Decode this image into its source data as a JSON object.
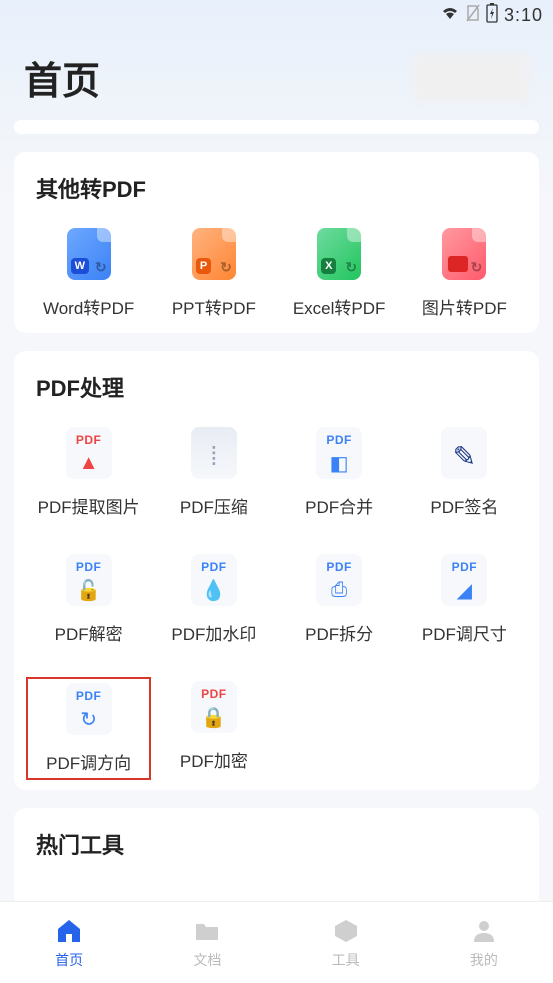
{
  "status": {
    "time": "3:10"
  },
  "header": {
    "title": "首页"
  },
  "sections": {
    "convert": {
      "title": "其他转PDF",
      "items": [
        {
          "label": "Word转PDF"
        },
        {
          "label": "PPT转PDF"
        },
        {
          "label": "Excel转PDF"
        },
        {
          "label": "图片转PDF"
        }
      ]
    },
    "process": {
      "title": "PDF处理",
      "items": [
        {
          "label": "PDF提取图片",
          "tag": "PDF",
          "tag_color": "red"
        },
        {
          "label": "PDF压缩",
          "tag": "",
          "tag_color": ""
        },
        {
          "label": "PDF合并",
          "tag": "PDF",
          "tag_color": "blue"
        },
        {
          "label": "PDF签名",
          "tag": "",
          "tag_color": ""
        },
        {
          "label": "PDF解密",
          "tag": "PDF",
          "tag_color": "blue"
        },
        {
          "label": "PDF加水印",
          "tag": "PDF",
          "tag_color": "blue"
        },
        {
          "label": "PDF拆分",
          "tag": "PDF",
          "tag_color": "blue"
        },
        {
          "label": "PDF调尺寸",
          "tag": "PDF",
          "tag_color": "blue"
        },
        {
          "label": "PDF调方向",
          "tag": "PDF",
          "tag_color": "blue",
          "highlighted": true
        },
        {
          "label": "PDF加密",
          "tag": "PDF",
          "tag_color": "red"
        }
      ]
    },
    "hot": {
      "title": "热门工具"
    }
  },
  "nav": {
    "items": [
      {
        "label": "首页",
        "active": true
      },
      {
        "label": "文档",
        "active": false
      },
      {
        "label": "工具",
        "active": false
      },
      {
        "label": "我的",
        "active": false
      }
    ]
  }
}
